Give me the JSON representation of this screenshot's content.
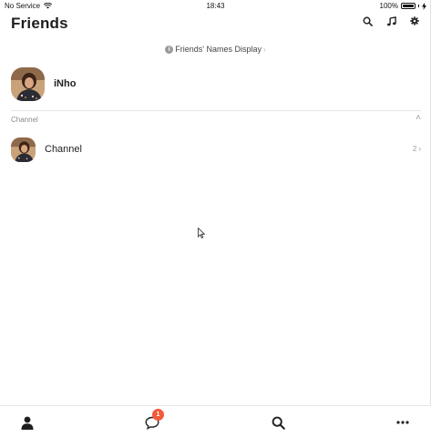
{
  "status_bar": {
    "carrier": "No Service",
    "time": "18:43",
    "battery": "100%",
    "battery_level": 1.0
  },
  "header": {
    "title": "Friends",
    "actions": [
      {
        "icon": "search-icon"
      },
      {
        "icon": "music-icon"
      },
      {
        "icon": "gear-icon"
      }
    ]
  },
  "names_display": {
    "info_symbol": "i",
    "label": "Friends' Names Display",
    "chevron": "›"
  },
  "profile": {
    "name": "iNho"
  },
  "channel_section": {
    "title": "Channel",
    "collapse_symbol": "˄",
    "items": [
      {
        "name": "Channel",
        "count": "2",
        "chevron": "›"
      }
    ]
  },
  "bottom_nav": {
    "items": [
      {
        "icon": "person-icon"
      },
      {
        "icon": "chat-bubble-icon",
        "badge": "1"
      },
      {
        "icon": "search-icon"
      },
      {
        "icon": "more-dots-icon"
      }
    ]
  },
  "colors": {
    "badge": "#f25b3a",
    "text_primary": "#1e1e1e",
    "text_muted": "#8a8a8a"
  }
}
